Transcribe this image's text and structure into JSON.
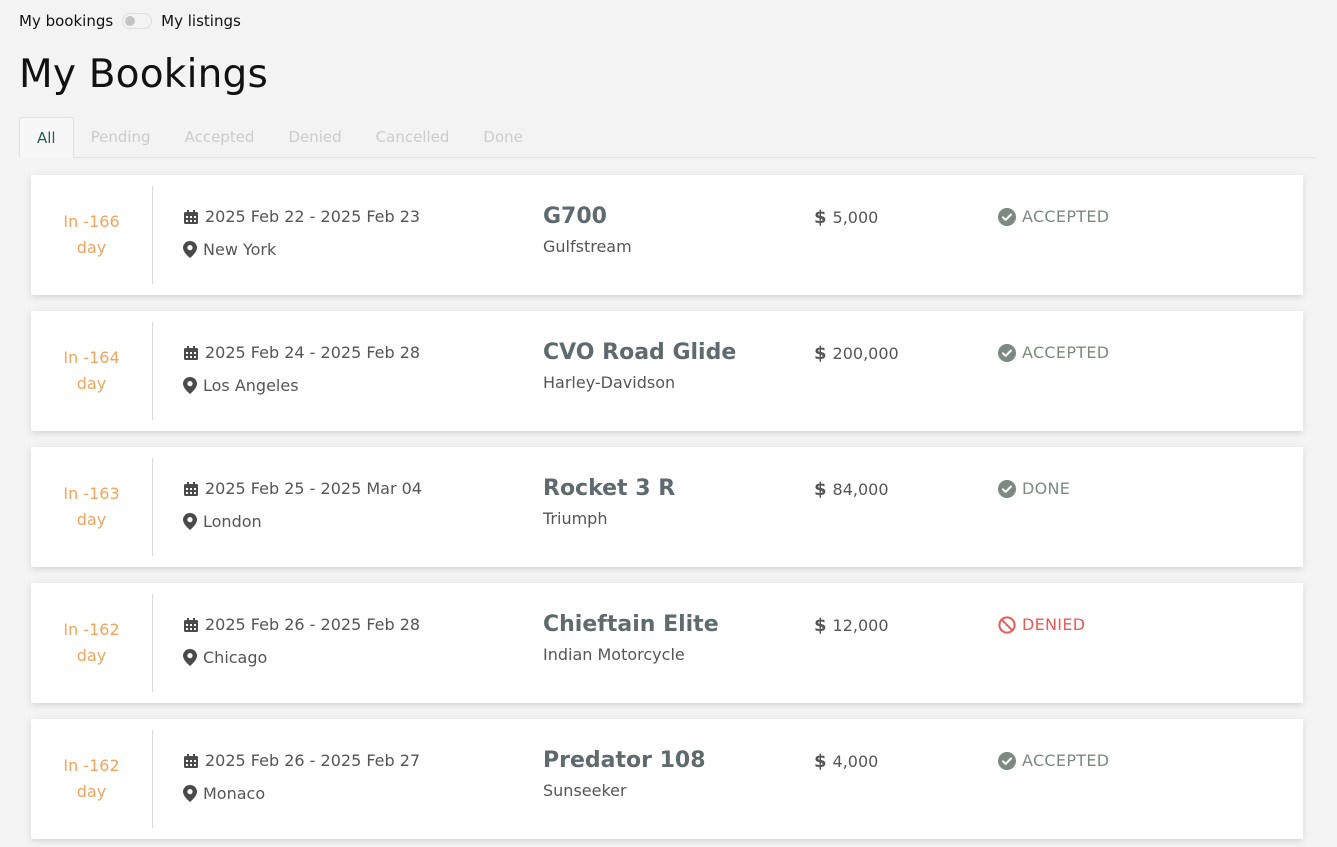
{
  "toggle": {
    "left_label": "My bookings",
    "right_label": "My listings"
  },
  "page_title": "My Bookings",
  "tabs": [
    {
      "label": "All"
    },
    {
      "label": "Pending"
    },
    {
      "label": "Accepted"
    },
    {
      "label": "Denied"
    },
    {
      "label": "Cancelled"
    },
    {
      "label": "Done"
    }
  ],
  "bookings": [
    {
      "countdown_line1": "In -166",
      "countdown_line2": "day",
      "dates": "2025 Feb 22 - 2025 Feb 23",
      "location": "New York",
      "model": "G700",
      "brand": "Gulfstream",
      "price": "5,000",
      "status": "ACCEPTED"
    },
    {
      "countdown_line1": "In -164",
      "countdown_line2": "day",
      "dates": "2025 Feb 24 - 2025 Feb 28",
      "location": "Los Angeles",
      "model": "CVO Road Glide",
      "brand": "Harley-Davidson",
      "price": "200,000",
      "status": "ACCEPTED"
    },
    {
      "countdown_line1": "In -163",
      "countdown_line2": "day",
      "dates": "2025 Feb 25 - 2025 Mar 04",
      "location": "London",
      "model": "Rocket 3 R",
      "brand": "Triumph",
      "price": "84,000",
      "status": "DONE"
    },
    {
      "countdown_line1": "In -162",
      "countdown_line2": "day",
      "dates": "2025 Feb 26 - 2025 Feb 28",
      "location": "Chicago",
      "model": "Chieftain Elite",
      "brand": "Indian Motorcycle",
      "price": "12,000",
      "status": "DENIED"
    },
    {
      "countdown_line1": "In -162",
      "countdown_line2": "day",
      "dates": "2025 Feb 26 - 2025 Feb 27",
      "location": "Monaco",
      "model": "Predator 108",
      "brand": "Sunseeker",
      "price": "4,000",
      "status": "ACCEPTED"
    }
  ],
  "currency_symbol": "$",
  "colors": {
    "countdown": "#f0a560",
    "status_ok": "#7c8a80",
    "status_denied": "#e95a5a",
    "active_tab": "#2b5b55"
  },
  "icons": {
    "dates": "calendar-icon",
    "location": "map-pin-icon",
    "status_ok": "check-circle-icon",
    "status_denied": "ban-icon"
  }
}
